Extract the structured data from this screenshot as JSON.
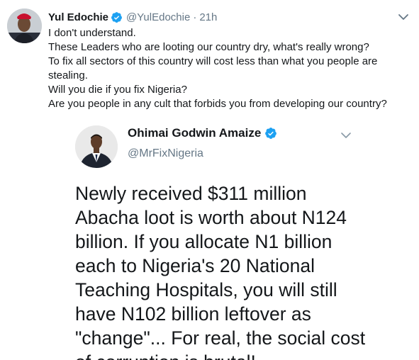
{
  "tweet": {
    "display_name": "Yul Edochie",
    "handle": "@YulEdochie",
    "separator": "·",
    "time": "21h",
    "lines": [
      "I don't understand.",
      "These Leaders who are looting our country dry, what's really wrong?",
      "To fix all sectors of this country will cost less than what you people are",
      "stealing.",
      "Will you die if you fix Nigeria?",
      "Are you people in any cult that forbids you from developing our country?"
    ]
  },
  "quote": {
    "display_name": "Ohimai Godwin Amaize",
    "handle": "@MrFixNigeria",
    "lines": [
      "Newly received $311 million",
      "Abacha loot is worth about N124",
      "billion. If you allocate N1 billion",
      "each to Nigeria's 20 National",
      "Teaching Hospitals, you will still",
      "have N102 billion leftover as",
      "\"change\"... For real, the social cost",
      "of corruption is brutal!"
    ]
  },
  "colors": {
    "verified": "#1da1f2",
    "secondary_text": "#657786",
    "primary_text": "#14171a"
  },
  "icons": {
    "verified": "verified-badge-icon",
    "caret": "chevron-down-icon"
  }
}
